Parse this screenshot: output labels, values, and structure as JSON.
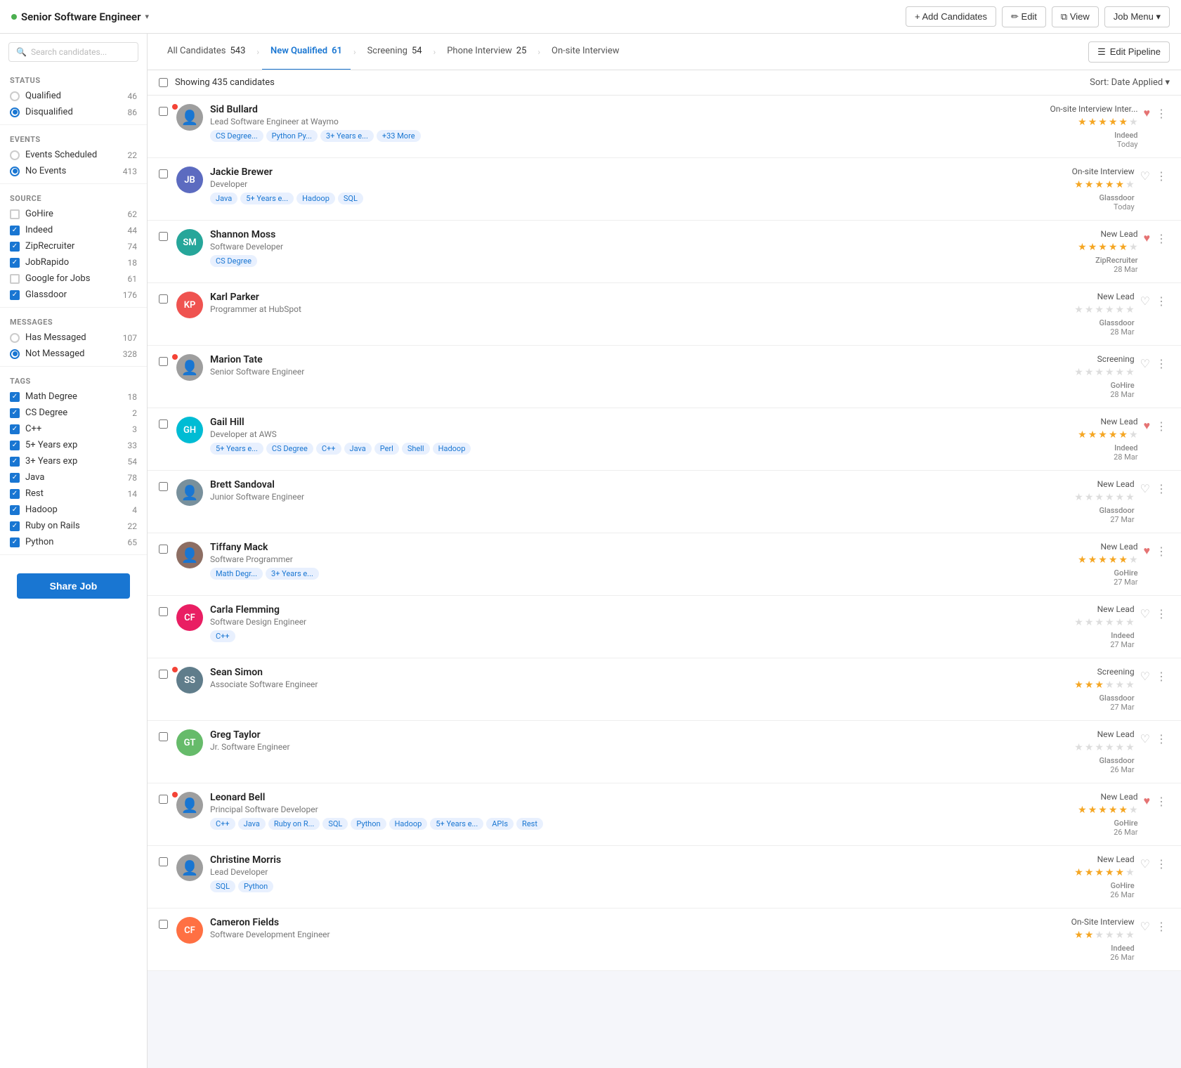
{
  "header": {
    "job_title": "Senior Software Engineer",
    "status_dot_color": "#4caf50",
    "add_candidates": "+ Add Candidates",
    "edit": "✏ Edit",
    "view": "⧉ View",
    "job_menu": "Job Menu ▾"
  },
  "pipeline_tabs": {
    "items": [
      {
        "label": "All Candidates",
        "count": "543",
        "active": false
      },
      {
        "label": "New Qualified",
        "count": "61",
        "active": true
      },
      {
        "label": "Screening",
        "count": "54",
        "active": false
      },
      {
        "label": "Phone Interview",
        "count": "25",
        "active": false
      },
      {
        "label": "On-site Interview",
        "count": "",
        "active": false
      }
    ],
    "edit_pipeline": "☰ Edit Pipeline"
  },
  "candidates_header": {
    "showing": "Showing 435 candidates",
    "sort": "Sort: Date Applied ▾"
  },
  "sidebar": {
    "search_placeholder": "Search candidates...",
    "sections": [
      {
        "title": "Status",
        "items": [
          {
            "type": "radio",
            "label": "Qualified",
            "count": "46",
            "active": false
          },
          {
            "type": "radio",
            "label": "Disqualified",
            "count": "86",
            "active": true
          }
        ]
      },
      {
        "title": "Events",
        "items": [
          {
            "type": "radio",
            "label": "Events Scheduled",
            "count": "22",
            "active": false
          },
          {
            "type": "radio",
            "label": "No Events",
            "count": "413",
            "active": true
          }
        ]
      },
      {
        "title": "Source",
        "items": [
          {
            "type": "checkbox",
            "label": "GoHire",
            "count": "62",
            "checked": false
          },
          {
            "type": "checkbox",
            "label": "Indeed",
            "count": "44",
            "checked": true
          },
          {
            "type": "checkbox",
            "label": "ZipRecruiter",
            "count": "74",
            "checked": true
          },
          {
            "type": "checkbox",
            "label": "JobRapido",
            "count": "18",
            "checked": true
          },
          {
            "type": "checkbox",
            "label": "Google for Jobs",
            "count": "61",
            "checked": false
          },
          {
            "type": "checkbox",
            "label": "Glassdoor",
            "count": "176",
            "checked": true
          }
        ]
      },
      {
        "title": "Messages",
        "items": [
          {
            "type": "radio",
            "label": "Has Messaged",
            "count": "107",
            "active": false
          },
          {
            "type": "radio",
            "label": "Not Messaged",
            "count": "328",
            "active": true
          }
        ]
      },
      {
        "title": "Tags",
        "items": [
          {
            "type": "checkbox",
            "label": "Math Degree",
            "count": "18",
            "checked": true
          },
          {
            "type": "checkbox",
            "label": "CS Degree",
            "count": "2",
            "checked": true
          },
          {
            "type": "checkbox",
            "label": "C++",
            "count": "3",
            "checked": true
          },
          {
            "type": "checkbox",
            "label": "5+ Years exp",
            "count": "33",
            "checked": true
          },
          {
            "type": "checkbox",
            "label": "3+ Years exp",
            "count": "54",
            "checked": true
          },
          {
            "type": "checkbox",
            "label": "Java",
            "count": "78",
            "checked": true
          },
          {
            "type": "checkbox",
            "label": "Rest",
            "count": "14",
            "checked": true
          },
          {
            "type": "checkbox",
            "label": "Hadoop",
            "count": "4",
            "checked": true
          },
          {
            "type": "checkbox",
            "label": "Ruby on Rails",
            "count": "22",
            "checked": true
          },
          {
            "type": "checkbox",
            "label": "Python",
            "count": "65",
            "checked": true
          }
        ]
      }
    ],
    "share_job": "Share Job"
  },
  "candidates": [
    {
      "id": 1,
      "name": "Sid Bullard",
      "title": "Lead Software Engineer at Waymo",
      "avatar_initials": "",
      "avatar_color": "#9e9e9e",
      "avatar_type": "photo",
      "has_dot": true,
      "dot_color": "#f44336",
      "tags": [
        "CS Degree...",
        "Python Py...",
        "3+ Years e...",
        "+33 More"
      ],
      "stage": "On-site Interview Inter...",
      "stars": [
        1,
        1,
        1,
        1,
        0.5,
        0
      ],
      "source": "Indeed",
      "date": "Today",
      "liked": true
    },
    {
      "id": 2,
      "name": "Jackie Brewer",
      "title": "Developer",
      "avatar_initials": "JB",
      "avatar_color": "#5c6bc0",
      "avatar_type": "initials",
      "has_dot": false,
      "tags": [
        "Java",
        "5+ Years e...",
        "Hadoop",
        "SQL"
      ],
      "stage": "On-site Interview",
      "stars": [
        1,
        1,
        1,
        1,
        0.5,
        0
      ],
      "source": "Glassdoor",
      "date": "Today",
      "liked": false
    },
    {
      "id": 3,
      "name": "Shannon Moss",
      "title": "Software Developer",
      "avatar_initials": "SM",
      "avatar_color": "#26a69a",
      "avatar_type": "initials",
      "has_dot": false,
      "tags": [
        "CS Degree"
      ],
      "stage": "New Lead",
      "stars": [
        1,
        1,
        1,
        1,
        0.5,
        0
      ],
      "source": "ZipRecruiter",
      "date": "28 Mar",
      "liked": true
    },
    {
      "id": 4,
      "name": "Karl Parker",
      "title": "Programmer at HubSpot",
      "avatar_initials": "KP",
      "avatar_color": "#ef5350",
      "avatar_type": "initials",
      "has_dot": false,
      "tags": [],
      "stage": "New Lead",
      "stars": [
        0,
        0,
        0,
        0,
        0,
        0
      ],
      "source": "Glassdoor",
      "date": "28 Mar",
      "liked": false
    },
    {
      "id": 5,
      "name": "Marion Tate",
      "title": "Senior Software Engineer",
      "avatar_initials": "",
      "avatar_color": "#9e9e9e",
      "avatar_type": "photo",
      "has_dot": true,
      "dot_color": "#f44336",
      "tags": [],
      "stage": "Screening",
      "stars": [
        0,
        0,
        0,
        0,
        0,
        0
      ],
      "source": "GoHire",
      "date": "28 Mar",
      "liked": false
    },
    {
      "id": 6,
      "name": "Gail Hill",
      "title": "Developer at AWS",
      "avatar_initials": "GH",
      "avatar_color": "#00bcd4",
      "avatar_type": "initials",
      "has_dot": false,
      "tags": [
        "5+ Years e...",
        "CS Degree",
        "C++",
        "Java",
        "Perl",
        "Shell",
        "Hadoop"
      ],
      "stage": "New Lead",
      "stars": [
        1,
        1,
        1,
        1,
        0.5,
        0
      ],
      "source": "Indeed",
      "date": "28 Mar",
      "liked": true
    },
    {
      "id": 7,
      "name": "Brett Sandoval",
      "title": "Junior Software Engineer",
      "avatar_initials": "",
      "avatar_color": "#78909c",
      "avatar_type": "photo",
      "has_dot": false,
      "tags": [],
      "stage": "New Lead",
      "stars": [
        0,
        0,
        0,
        0,
        0,
        0
      ],
      "source": "Glassdoor",
      "date": "27 Mar",
      "liked": false
    },
    {
      "id": 8,
      "name": "Tiffany Mack",
      "title": "Software Programmer",
      "avatar_initials": "",
      "avatar_color": "#8d6e63",
      "avatar_type": "photo",
      "has_dot": false,
      "tags": [
        "Math Degr...",
        "3+ Years e..."
      ],
      "stage": "New Lead",
      "stars": [
        1,
        1,
        1,
        1,
        0.5,
        0
      ],
      "source": "GoHire",
      "date": "27 Mar",
      "liked": true
    },
    {
      "id": 9,
      "name": "Carla Flemming",
      "title": "Software Design Engineer",
      "avatar_initials": "CF",
      "avatar_color": "#e91e63",
      "avatar_type": "initials",
      "has_dot": false,
      "tags": [
        "C++"
      ],
      "stage": "New Lead",
      "stars": [
        0,
        0,
        0,
        0,
        0,
        0
      ],
      "source": "Indeed",
      "date": "27 Mar",
      "liked": false
    },
    {
      "id": 10,
      "name": "Sean Simon",
      "title": "Associate Software Engineer",
      "avatar_initials": "SS",
      "avatar_color": "#607d8b",
      "avatar_type": "initials",
      "has_dot": true,
      "dot_color": "#f44336",
      "tags": [],
      "stage": "Screening",
      "stars": [
        1,
        1,
        0.5,
        0,
        0,
        0
      ],
      "source": "Glassdoor",
      "date": "27 Mar",
      "liked": false
    },
    {
      "id": 11,
      "name": "Greg Taylor",
      "title": "Jr. Software Engineer",
      "avatar_initials": "GT",
      "avatar_color": "#66bb6a",
      "avatar_type": "initials",
      "has_dot": false,
      "tags": [],
      "stage": "New Lead",
      "stars": [
        0,
        0,
        0,
        0,
        0,
        0
      ],
      "source": "Glassdoor",
      "date": "26 Mar",
      "liked": false
    },
    {
      "id": 12,
      "name": "Leonard Bell",
      "title": "Principal Software Developer",
      "avatar_initials": "",
      "avatar_color": "#9e9e9e",
      "avatar_type": "photo",
      "has_dot": true,
      "dot_color": "#f44336",
      "tags": [
        "C++",
        "Java",
        "Ruby on R...",
        "SQL",
        "Python",
        "Hadoop",
        "5+ Years e...",
        "APIs",
        "Rest"
      ],
      "stage": "New Lead",
      "stars": [
        1,
        1,
        1,
        1,
        1,
        0
      ],
      "source": "GoHire",
      "date": "26 Mar",
      "liked": true
    },
    {
      "id": 13,
      "name": "Christine Morris",
      "title": "Lead Developer",
      "avatar_initials": "",
      "avatar_color": "#9e9e9e",
      "avatar_type": "photo",
      "has_dot": false,
      "tags": [
        "SQL",
        "Python"
      ],
      "stage": "New Lead",
      "stars": [
        1,
        1,
        1,
        1,
        0.5,
        0
      ],
      "source": "GoHire",
      "date": "26 Mar",
      "liked": false
    },
    {
      "id": 14,
      "name": "Cameron Fields",
      "title": "Software Development Engineer",
      "avatar_initials": "CF",
      "avatar_color": "#ff7043",
      "avatar_type": "initials",
      "has_dot": false,
      "tags": [],
      "stage": "On-Site Interview",
      "stars": [
        1,
        1,
        0,
        0,
        0,
        0
      ],
      "source": "Indeed",
      "date": "26 Mar",
      "liked": false
    }
  ]
}
